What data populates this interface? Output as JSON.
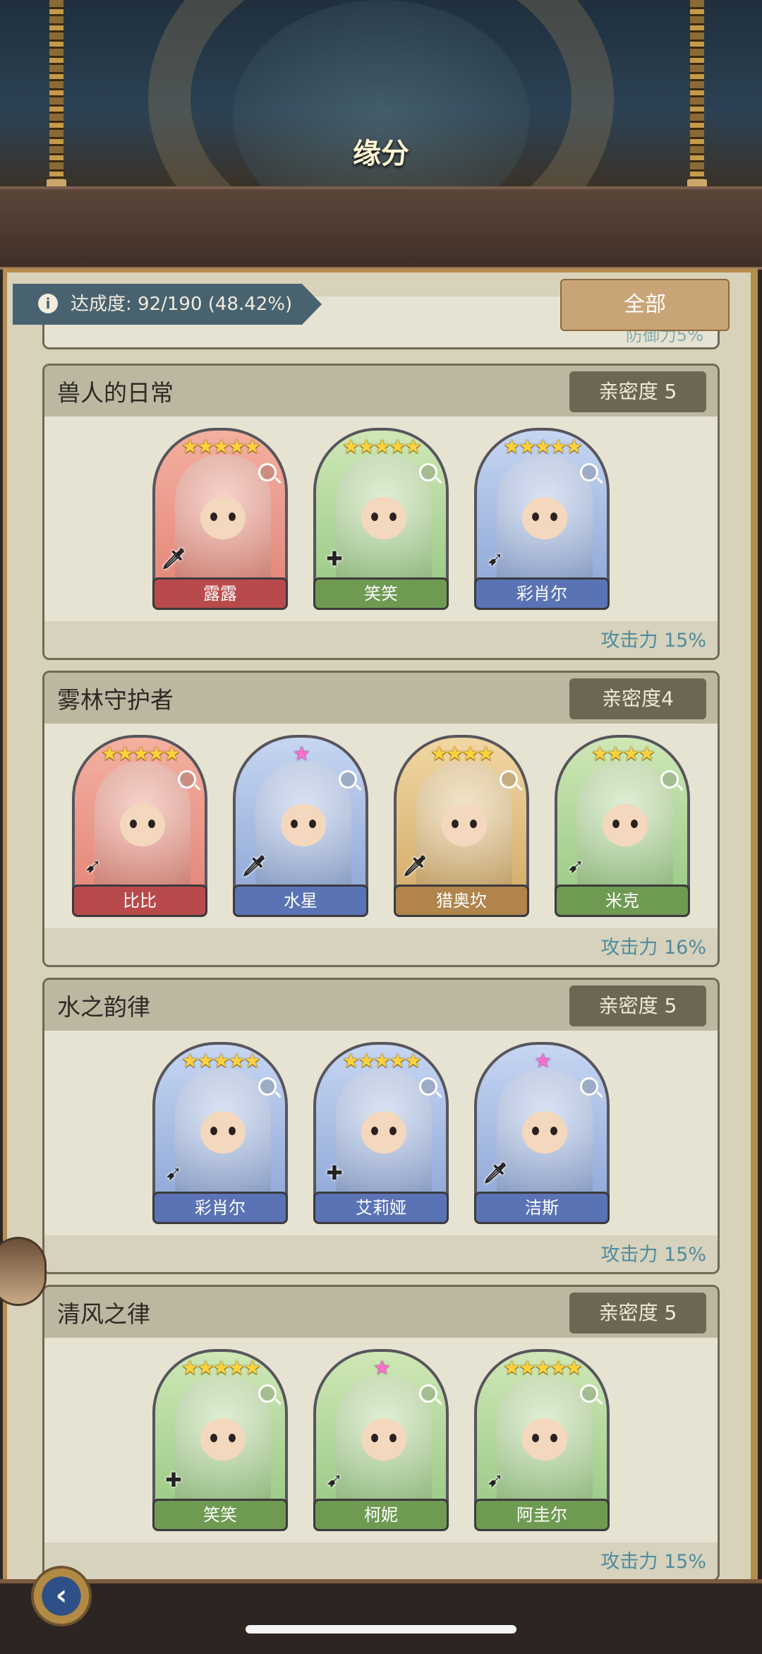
{
  "header": {
    "title": "缘分"
  },
  "progress": {
    "label": "达成度: 92/190 (48.42%)"
  },
  "filter_button": {
    "label": "全部"
  },
  "partial_card": {
    "bonus": "防御力5%"
  },
  "groups": [
    {
      "title": "兽人的日常",
      "affinity": "亲密度 5",
      "bonus": "攻击力 15%",
      "characters": [
        {
          "name": "露露",
          "stars": "★★★★★",
          "role": "🗡",
          "color": "red"
        },
        {
          "name": "笑笑",
          "stars": "★★★★★",
          "role": "✚",
          "color": "green"
        },
        {
          "name": "彩肖尔",
          "stars": "★★★★★",
          "role": "➹",
          "color": "blue"
        }
      ]
    },
    {
      "title": "雾林守护者",
      "affinity": "亲密度4",
      "bonus": "攻击力 16%",
      "characters": [
        {
          "name": "比比",
          "stars": "★★★★★",
          "role": "➹",
          "color": "red"
        },
        {
          "name": "水星",
          "stars": "★",
          "role": "🗡",
          "color": "blue"
        },
        {
          "name": "猎奥坎",
          "stars": "★★★★",
          "role": "🗡",
          "color": "gold"
        },
        {
          "name": "米克",
          "stars": "★★★★",
          "role": "➹",
          "color": "green"
        }
      ]
    },
    {
      "title": "水之韵律",
      "affinity": "亲密度 5",
      "bonus": "攻击力 15%",
      "characters": [
        {
          "name": "彩肖尔",
          "stars": "★★★★★",
          "role": "➹",
          "color": "blue"
        },
        {
          "name": "艾莉娅",
          "stars": "★★★★★",
          "role": "✚",
          "color": "blue"
        },
        {
          "name": "洁斯",
          "stars": "★",
          "role": "🗡",
          "color": "blue"
        }
      ]
    },
    {
      "title": "清风之律",
      "affinity": "亲密度 5",
      "bonus": "攻击力 15%",
      "characters": [
        {
          "name": "笑笑",
          "stars": "★★★★★",
          "role": "✚",
          "color": "green"
        },
        {
          "name": "柯妮",
          "stars": "★",
          "role": "➹",
          "color": "green"
        },
        {
          "name": "阿圭尔",
          "stars": "★★★★★",
          "role": "➹",
          "color": "green"
        }
      ]
    }
  ],
  "icons": {
    "info": "info-icon",
    "magnifier": "magnifier-icon",
    "back": "back-arrow-icon"
  },
  "back_button": {
    "label": "‹"
  }
}
